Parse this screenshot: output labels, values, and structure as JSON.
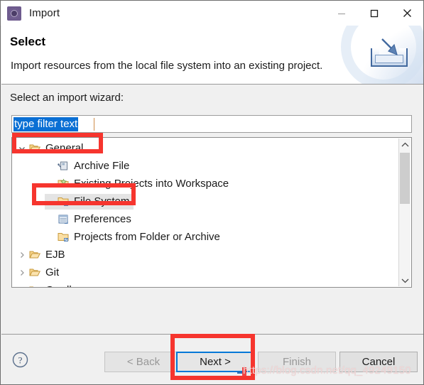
{
  "window": {
    "title": "Import",
    "icon": "eclipse-import-icon",
    "controls": {
      "minimize": "minimize-icon",
      "maximize": "maximize-icon",
      "close": "close-icon"
    }
  },
  "header": {
    "title": "Select",
    "description": "Import resources from the local file system into an existing project.",
    "art": "import-tray-arrow-icon"
  },
  "body": {
    "prompt": "Select an import wizard:",
    "filter": {
      "value": "type filter text",
      "placeholder": "type filter text",
      "selected": true
    }
  },
  "tree": {
    "items": [
      {
        "label": "General",
        "level": 0,
        "icon": "open-folder-icon",
        "twisty": "expanded",
        "selected": false
      },
      {
        "label": "Archive File",
        "level": 1,
        "icon": "archive-file-icon",
        "twisty": "none",
        "selected": false
      },
      {
        "label": "Existing Projects into Workspace",
        "level": 1,
        "icon": "existing-projects-icon",
        "twisty": "none",
        "selected": false
      },
      {
        "label": "File System",
        "level": 1,
        "icon": "folder-icon",
        "twisty": "none",
        "selected": true
      },
      {
        "label": "Preferences",
        "level": 1,
        "icon": "preferences-icon",
        "twisty": "none",
        "selected": false
      },
      {
        "label": "Projects from Folder or Archive",
        "level": 1,
        "icon": "folder-icon",
        "twisty": "none",
        "selected": false
      },
      {
        "label": "EJB",
        "level": 0,
        "icon": "open-folder-icon",
        "twisty": "collapsed",
        "selected": false
      },
      {
        "label": "Git",
        "level": 0,
        "icon": "open-folder-icon",
        "twisty": "collapsed",
        "selected": false
      },
      {
        "label": "Gradle",
        "level": 0,
        "icon": "open-folder-icon",
        "twisty": "collapsed",
        "selected": false
      }
    ],
    "scrollbar": {
      "up": "chevron-up-icon",
      "down": "chevron-down-icon"
    }
  },
  "buttons": {
    "help": "help-icon",
    "back": {
      "label": "< Back",
      "enabled": false
    },
    "next": {
      "label": "Next >",
      "enabled": true,
      "focused": true
    },
    "finish": {
      "label": "Finish",
      "enabled": false
    },
    "cancel": {
      "label": "Cancel",
      "enabled": true
    }
  },
  "annotations": [
    {
      "name": "general-highlight",
      "target": "General"
    },
    {
      "name": "file-system-highlight",
      "target": "File System"
    },
    {
      "name": "next-button-highlight",
      "target": "Next >"
    }
  ],
  "watermark": {
    "text": "https://blog.csdn.net/qq_49249150"
  },
  "colors": {
    "accent": "#0078d7",
    "annotation": "#f6352e",
    "selection": "#0a6fd4",
    "dialog_bg": "#f0f0f0"
  }
}
